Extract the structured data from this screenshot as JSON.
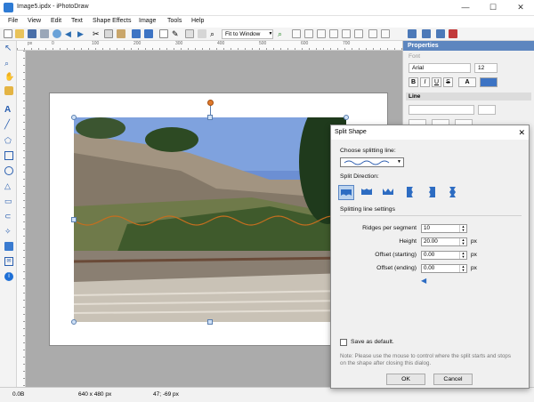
{
  "window": {
    "title": "Image5.ipdx - iPhotoDraw",
    "minimize": "—",
    "maximize": "☐",
    "close": "✕"
  },
  "menu": [
    "File",
    "View",
    "Edit",
    "Text",
    "Shape Effects",
    "Image",
    "Tools",
    "Help"
  ],
  "toolbar": {
    "zoom_select": "Fit to Window"
  },
  "ruler": {
    "h_labels": [
      "px",
      "0",
      "100",
      "200",
      "300",
      "400",
      "500",
      "600",
      "700"
    ]
  },
  "properties": {
    "title": "Properties",
    "font_section": "Font",
    "font_name": "Arial",
    "font_size": "12",
    "bold": "B",
    "italic": "I",
    "underline": "U",
    "strike": "S",
    "line_section": "Line"
  },
  "status": {
    "size": "0.0B",
    "dimensions": "640 x 480 px",
    "cursor": "47; -69 px"
  },
  "dialog": {
    "title": "Split Shape",
    "close": "✕",
    "choose_line": "Choose splitting line:",
    "split_direction": "Split Direction:",
    "settings": "Splitting line settings",
    "ridges_label": "Ridges per segment",
    "ridges_value": "10",
    "height_label": "Height",
    "height_value": "20.00",
    "offset_start_label": "Offset (starting)",
    "offset_start_value": "0.00",
    "offset_end_label": "Offset (ending)",
    "offset_end_value": "0.00",
    "unit": "px",
    "save_default": "Save as default.",
    "note": "Note: Please use the mouse to control where the split starts and stops on the shape after closing this dialog.",
    "ok": "OK",
    "cancel": "Cancel"
  },
  "colors": {
    "accent": "#5d86bf",
    "rotate_handle": "#e07a2c",
    "wave": "#c46e1f"
  }
}
